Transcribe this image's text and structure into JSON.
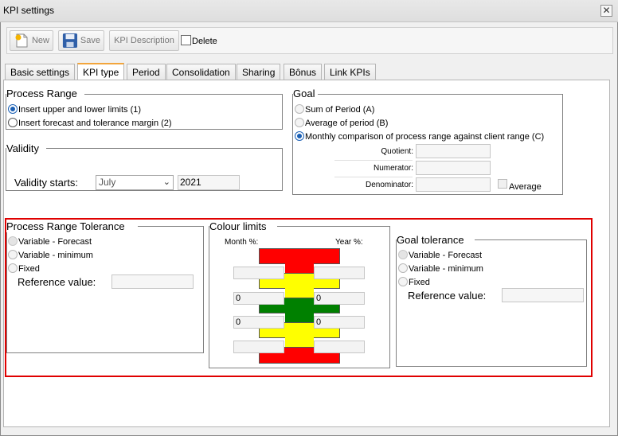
{
  "window": {
    "title": "KPI settings"
  },
  "toolbar": {
    "new_label": "New",
    "save_label": "Save",
    "kpi_description_label": "KPI Description",
    "delete_label": "Delete"
  },
  "tabs": [
    {
      "label": "Basic settings"
    },
    {
      "label": "KPI type"
    },
    {
      "label": "Period"
    },
    {
      "label": "Consolidation"
    },
    {
      "label": "Sharing"
    },
    {
      "label": "Bônus"
    },
    {
      "label": "Link KPIs"
    }
  ],
  "process_range": {
    "title": "Process Range",
    "options": [
      "Insert upper and lower limits (1)",
      "Insert forecast and tolerance margin (2)"
    ],
    "selected": 0
  },
  "validity": {
    "title": "Validity",
    "label": "Validity starts:",
    "month": "July",
    "year": "2021"
  },
  "goal": {
    "title": "Goal",
    "options": [
      "Sum of Period (A)",
      "Average of period (B)",
      "Monthly comparison of process range against client range (C)"
    ],
    "selected": 2,
    "quotient_label": "Quotient:",
    "numerator_label": "Numerator:",
    "denominator_label": "Denominator:",
    "average_label": "Average"
  },
  "process_range_tolerance": {
    "title": "Process Range Tolerance",
    "options": [
      "Variable - Forecast",
      "Variable - minimum",
      "Fixed"
    ],
    "reference_label": "Reference value:"
  },
  "colour_limits": {
    "title": "Colour limits",
    "month_label": "Month %:",
    "year_label": "Year %:",
    "month_values": [
      "",
      "0",
      "0",
      ""
    ],
    "year_values": [
      "",
      "0",
      "0",
      ""
    ],
    "colors": {
      "red": "#ff0000",
      "yellow": "#ffff00",
      "green": "#008000"
    }
  },
  "goal_tolerance": {
    "title": "Goal tolerance",
    "options": [
      "Variable - Forecast",
      "Variable - minimum",
      "Fixed"
    ],
    "reference_label": "Reference value:"
  },
  "theme": {
    "highlight": "#e00000",
    "active_tab": "#f2a53c",
    "radio_selected": "#1a5fb4"
  }
}
